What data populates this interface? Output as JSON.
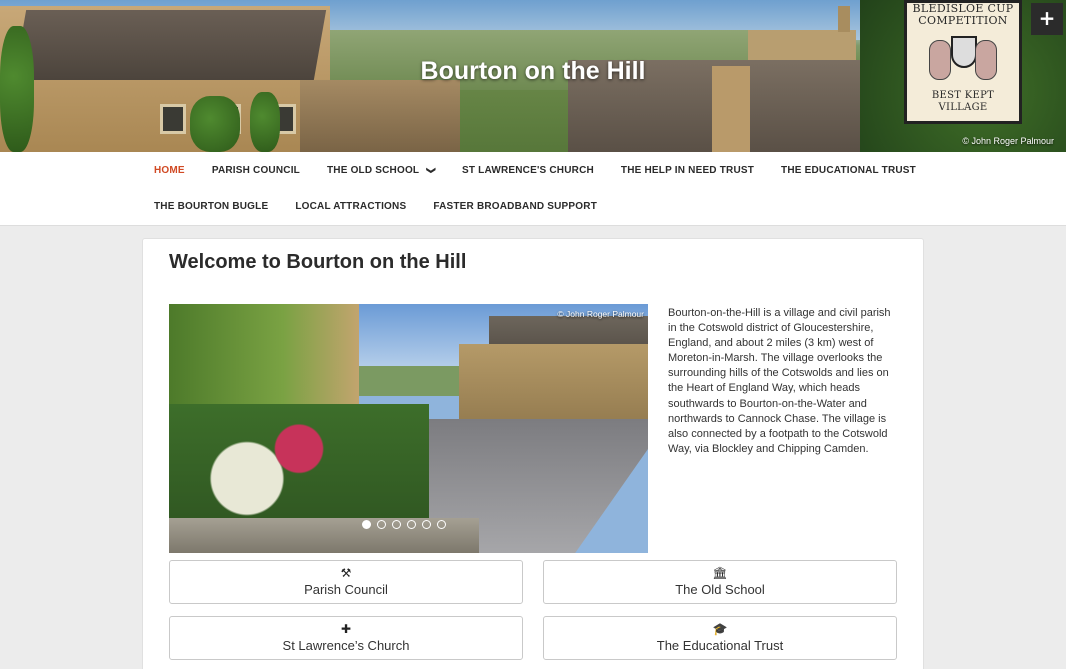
{
  "header": {
    "site_title": "Bourton on the Hill",
    "photo_credit": "© John Roger Palmour",
    "sign": {
      "line1": "BLEDISLOE CUP",
      "line2": "COMPETITION",
      "line3": "BEST KEPT VILLAGE"
    },
    "toggle_icon": "+"
  },
  "nav": {
    "row1": [
      {
        "label": "HOME",
        "active": true
      },
      {
        "label": "PARISH COUNCIL"
      },
      {
        "label": "THE OLD SCHOOL",
        "has_dropdown": true
      },
      {
        "label": "ST LAWRENCE'S CHURCH"
      },
      {
        "label": "THE HELP IN NEED TRUST"
      },
      {
        "label": "THE EDUCATIONAL TRUST"
      }
    ],
    "row2": [
      {
        "label": "THE BOURTON BUGLE"
      },
      {
        "label": "LOCAL ATTRACTIONS"
      },
      {
        "label": "FASTER BROADBAND SUPPORT"
      }
    ],
    "dropdown_icon": "chevron-down-icon",
    "dropdown_glyph": "❯"
  },
  "main": {
    "page_title": "Welcome to Bourton on the Hill",
    "slider": {
      "credit": "© John Roger Palmour",
      "slide_count": 6,
      "active_slide": 1
    },
    "intro_text": "Bourton-on-the-Hill is a village and civil parish in the Cotswold district of Gloucestershire, England, and about 2 miles (3 km) west of Moreton-in-Marsh. The village overlooks the surrounding hills of the Cotswolds and lies on the Heart of England Way, which heads southwards to Bourton-on-the-Water and northwards to Cannock Chase. The village is also connected by a footpath to the Cotswold Way, via Blockley and Chipping Camden.",
    "tiles": [
      {
        "label": "Parish Council",
        "icon": "gavel-icon",
        "glyph": "⚒"
      },
      {
        "label": "The Old School",
        "icon": "building-icon",
        "glyph": "🏛"
      },
      {
        "label": "St Lawrence’s Church",
        "icon": "cross-icon",
        "glyph": "✚"
      },
      {
        "label": "The Educational Trust",
        "icon": "graduation-cap-icon",
        "glyph": "🎓"
      }
    ]
  },
  "colors": {
    "accent": "#d14a24",
    "nav_text": "#2b2b2b",
    "background": "#ececec"
  }
}
